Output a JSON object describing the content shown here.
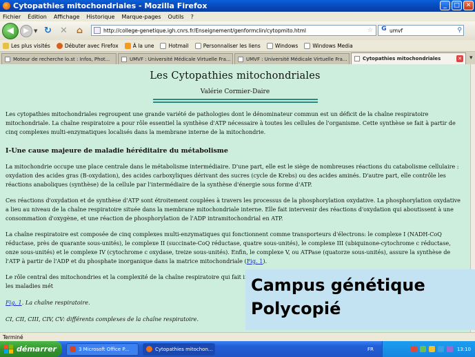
{
  "window": {
    "title": "Cytopathies mitochondriales - Mozilla Firefox"
  },
  "menu": [
    "Fichier",
    "Édition",
    "Affichage",
    "Historique",
    "Marque-pages",
    "Outils",
    "?"
  ],
  "nav": {
    "url": "http://college-genetique.igh.cnrs.fr/Enseignement/genformclin/cytopmito.html",
    "search_value": "umvf"
  },
  "bookmarks": [
    "Les plus visités",
    "Débuter avec Firefox",
    "À la une",
    "Hotmail",
    "Personnaliser les liens",
    "Windows",
    "Windows Media"
  ],
  "tabs": [
    {
      "label": "Moteur de recherche lo.st : Infos, Phot..."
    },
    {
      "label": "UMVF : Université Médicale Virtuelle Fra..."
    },
    {
      "label": "UMVF : Université Médicale Virtuelle Fra..."
    },
    {
      "label": "Cytopathies mitochondriales"
    }
  ],
  "doc": {
    "title": "Les Cytopathies mitochondriales",
    "author": "Valérie Cormier-Daire",
    "intro": "Les cytopathies mitochondriales regroupent une grande variété de pathologies dont le dénominateur commun est un déficit de la chaîne respiratoire mitochondriale. La chaîne respiratoire a pour rôle essentiel la synthèse d'ATP nécessaire à toutes les cellules de l'organisme. Cette synthèse se fait à partir de cinq complexes multi-enzymatiques localisés dans la membrane interne de la mitochondrie.",
    "section1_heading": "I-Une cause majeure de maladie héréditaire du métabolisme",
    "para1": "La mitochondrie occupe une place centrale dans le métabolisme intermédiaire. D'une part, elle est le siège de nombreuses réactions du catabolisme cellulaire : oxydation des acides gras (B-oxydation), des acides carboxyliques dérivant des sucres (cycle de Krebs) ou des acides aminés. D'autre part, elle contrôle les réactions anaboliques (synthèse) de la cellule par l'intermédiaire de la synthèse d'énergie sous forme d'ATP.",
    "para2": "Ces réactions d'oxydation et de synthèse d'ATP sont étroitement couplées à travers les processus de la phosphorylation oxydative. La phosphorylation oxydative a lieu au niveau de la chaîne respiratoire située dans la membrane mitochondriale interne. Elle fait intervenir des réactions d'oxydation qui aboutissent à une consommation d'oxygène, et une réaction de phosphorylation de l'ADP intramitochondrial en ATP.",
    "para3": "La chaîne respiratoire est composée de cinq complexes multi-enzymatiques qui fonctionnent comme transporteurs d'électrons: le complexe I (NADH-CoQ réductase, près de quarante sous-unités), le complexe II (succinate-CoQ réductase, quatre sous-unités), le complexe III (ubiquinone-cytochrome c réductase, onze sous-unités) et le complexe IV (cytochrome c oxydase, treize sous-unités). Enfin, le complexe V, ou ATPase (quatorze sous-unités), assure la synthèse de l'ATP à partir de l'ADP et du phosphate inorganique dans la matrice mitochondriale (",
    "para3_link": "Fig. 1",
    "para3_end": ").",
    "para4": "Le rôle central des mitochondries et la complexité de la chaîne respiratoire qui fait inter sévérité et la grande fréquence des cytopathies mitochondriales parmi les maladies mét",
    "caption_link": "Fig. 1",
    "caption_text": ". La chaîne respiratoire.",
    "caption2": "CI, CII, CIII, CIV, CV: différents complexes de la chaîne respiratoire."
  },
  "overlay": {
    "line1": "Campus génétique",
    "line2": "Polycopié"
  },
  "status": "Terminé",
  "taskbar": {
    "start": "démarrer",
    "tasks": [
      "3 Microsoft Office P...",
      "Cytopathies mitochon..."
    ],
    "lang": "FR",
    "clock": "13:10"
  }
}
